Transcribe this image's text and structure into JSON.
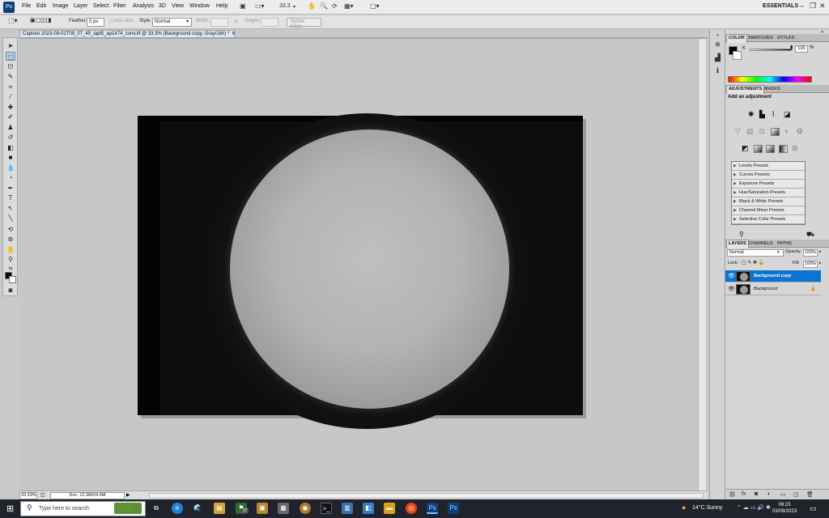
{
  "app": {
    "logo": "Ps",
    "menus": [
      "File",
      "Edit",
      "Image",
      "Layer",
      "Select",
      "Filter",
      "Analysis",
      "3D",
      "View",
      "Window",
      "Help"
    ],
    "zoom_menu": "33.3",
    "workspace": "ESSENTIALS"
  },
  "options_bar": {
    "feather_label": "Feather:",
    "feather_value": "0 px",
    "anti_alias": "Anti-alias",
    "style_label": "Style:",
    "style_value": "Normal",
    "width_label": "Width:",
    "height_label": "Height:",
    "refine_edge": "Refine Edge..."
  },
  "document": {
    "tab_title": "Capture 2023-09-01T09_07_45_lapl5_ap1474_conv.tif @ 33.3% (Background copy, Gray/16#) *",
    "zoom": "33.33%",
    "doc_size": "Doc: 12.3M/24.6M"
  },
  "color_panel": {
    "tabs": [
      "COLOR",
      "SWATCHES",
      "STYLES"
    ],
    "channel_label": "K",
    "value": "100",
    "unit": "%",
    "k_level": 1.0
  },
  "adjustments_panel": {
    "tabs": [
      "ADJUSTMENTS",
      "MASKS"
    ],
    "title": "Add an adjustment",
    "presets": [
      "Levels Presets",
      "Curves Presets",
      "Exposure Presets",
      "Hue/Saturation Presets",
      "Black & White Presets",
      "Channel Mixer Presets",
      "Selective Color Presets"
    ]
  },
  "layers_panel": {
    "tabs": [
      "LAYERS",
      "CHANNELS",
      "PATHS"
    ],
    "blend_mode": "Normal",
    "opacity_label": "Opacity:",
    "opacity": "100%",
    "lock_label": "Lock:",
    "fill_label": "Fill:",
    "fill": "100%",
    "layers": [
      {
        "name": "Background copy",
        "selected": true
      },
      {
        "name": "Background",
        "selected": false
      }
    ]
  },
  "taskbar": {
    "search_placeholder": "Type here to search",
    "weather": "14°C  Sunny",
    "time": "08:23",
    "date": "03/09/2023",
    "badge": "37"
  },
  "colors": {
    "selection_blue": "#0a75d0",
    "ps_logo_bg": "#0f3f7a"
  }
}
